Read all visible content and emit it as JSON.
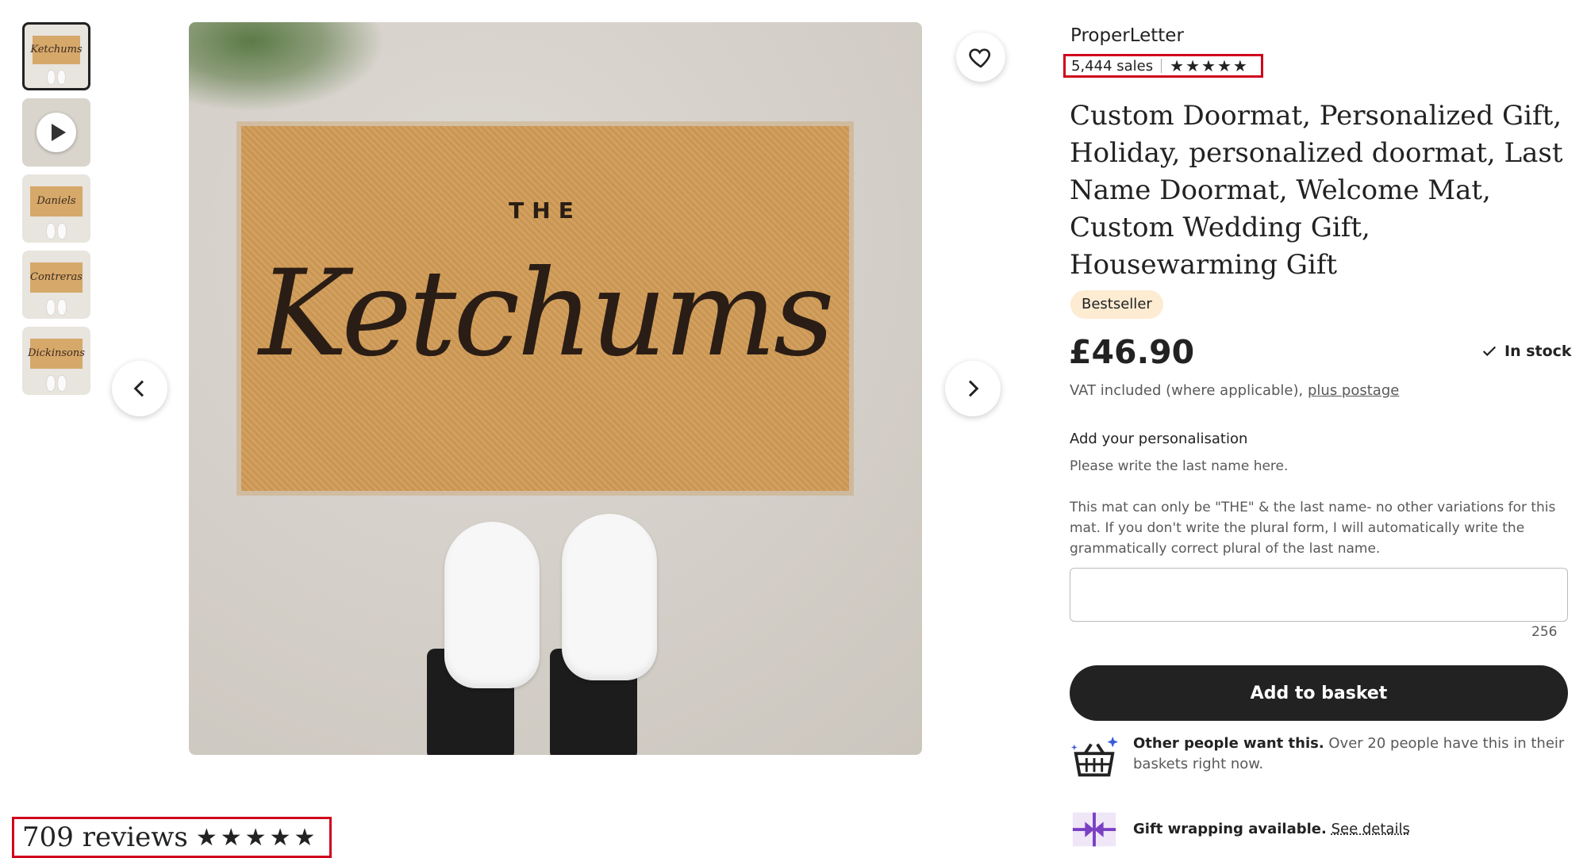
{
  "gallery": {
    "thumbnails": [
      {
        "label": "Ketchums",
        "type": "image"
      },
      {
        "label": "",
        "type": "video"
      },
      {
        "label": "Daniels",
        "type": "image"
      },
      {
        "label": "Contreras",
        "type": "image"
      },
      {
        "label": "Dickinsons",
        "type": "image"
      }
    ],
    "main_image": {
      "mat_header": "THE",
      "mat_name": "Ketchums"
    }
  },
  "shop": {
    "name": "ProperLetter",
    "sales": "5,444 sales",
    "rating_stars": 5
  },
  "listing": {
    "title": "Custom Doormat, Personalized Gift, Holiday, personalized doormat, Last Name Doormat, Welcome Mat, Custom Wedding Gift, Housewarming Gift",
    "badge": "Bestseller",
    "price": "£46.90",
    "stock": "In stock",
    "vat_text": "VAT included (where applicable),",
    "vat_link": "plus postage"
  },
  "personalisation": {
    "label": "Add your personalisation",
    "help": "Please write the last name here.",
    "note": "This mat can only be \"THE\" & the last name- no other variations for this mat. If you don't write the plural form, I will automatically write the grammatically correct plural of the last name.",
    "value": "",
    "char_count": "256"
  },
  "actions": {
    "add_to_basket": "Add to basket"
  },
  "promos": {
    "demand_bold": "Other people want this.",
    "demand_text": " Over 20 people have this in their baskets right now.",
    "gift_bold": "Gift wrapping available.",
    "gift_link": "See details"
  },
  "reviews": {
    "count_label": "709 reviews",
    "rating_stars": 5
  },
  "colors": {
    "highlight_box": "#d0021b",
    "badge_bg": "#fdebd2",
    "button_bg": "#222222"
  }
}
